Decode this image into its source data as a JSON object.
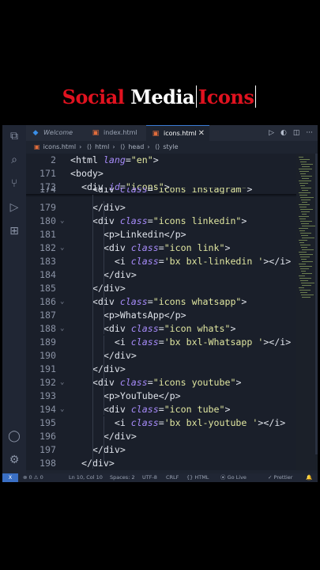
{
  "title": {
    "word1": "Social",
    "word2": "Media",
    "word3": "Icons"
  },
  "tabs": [
    {
      "label": "Welcome",
      "icon": "vscode-icon"
    },
    {
      "label": "index.html",
      "icon": "html5-icon"
    },
    {
      "label": "icons.html",
      "icon": "html5-icon",
      "active": true
    }
  ],
  "breadcrumb": [
    "icons.html",
    "html",
    "head",
    "style"
  ],
  "code_lines": [
    {
      "n": "2",
      "fold": "",
      "html": "<span class='p'>&lt;</span><span class='t'>html</span> <span class='a'>lang</span><span class='p'>=</span><span class='s'>\"en\"</span><span class='p'>&gt;</span>"
    },
    {
      "n": "171",
      "fold": "",
      "html": "<span class='p'>&lt;</span><span class='t'>body</span><span class='p'>&gt;</span>"
    },
    {
      "n": "173",
      "fold": "",
      "html": "  <span class='p'>&lt;</span><span class='t'>div</span> <span class='a'>id</span><span class='p'>=</span><span class='s'>\"icons\"</span><span class='p'>&gt;</span>"
    },
    {
      "n": "174",
      "fold": "",
      "html": "    <span class='p'>&lt;</span><span class='t'>div</span> <span class='a'>class</span><span class='p'>=</span><span class='s'>\"icons instagram\"</span><span class='p'>&gt;</span>"
    },
    {
      "n": "179",
      "fold": "",
      "html": "    <span class='p'>&lt;/</span><span class='t'>div</span><span class='p'>&gt;</span>"
    },
    {
      "n": "180",
      "fold": "v",
      "html": "    <span class='p'>&lt;</span><span class='t'>div</span> <span class='a'>class</span><span class='p'>=</span><span class='s'>\"icons linkedin\"</span><span class='p'>&gt;</span>"
    },
    {
      "n": "181",
      "fold": "",
      "html": "      <span class='p'>&lt;</span><span class='t'>p</span><span class='p'>&gt;Linkedin&lt;/</span><span class='t'>p</span><span class='p'>&gt;</span>"
    },
    {
      "n": "182",
      "fold": "v",
      "html": "      <span class='p'>&lt;</span><span class='t'>div</span> <span class='a'>class</span><span class='p'>=</span><span class='s'>\"icon link\"</span><span class='p'>&gt;</span>"
    },
    {
      "n": "183",
      "fold": "",
      "html": "        <span class='p'>&lt;</span><span class='t'>i</span> <span class='a'>class</span><span class='p'>=</span><span class='s'>'bx bxl-linkedin '</span><span class='p'>&gt;&lt;/</span><span class='t'>i</span><span class='p'>&gt;</span>"
    },
    {
      "n": "184",
      "fold": "",
      "html": "      <span class='p'>&lt;/</span><span class='t'>div</span><span class='p'>&gt;</span>"
    },
    {
      "n": "185",
      "fold": "",
      "html": "    <span class='p'>&lt;/</span><span class='t'>div</span><span class='p'>&gt;</span>"
    },
    {
      "n": "186",
      "fold": "v",
      "html": "    <span class='p'>&lt;</span><span class='t'>div</span> <span class='a'>class</span><span class='p'>=</span><span class='s'>\"icons whatsapp\"</span><span class='p'>&gt;</span>"
    },
    {
      "n": "187",
      "fold": "",
      "html": "      <span class='p'>&lt;</span><span class='t'>p</span><span class='p'>&gt;WhatsApp&lt;/</span><span class='t'>p</span><span class='p'>&gt;</span>"
    },
    {
      "n": "188",
      "fold": "v",
      "html": "      <span class='p'>&lt;</span><span class='t'>div</span> <span class='a'>class</span><span class='p'>=</span><span class='s'>\"icon whats\"</span><span class='p'>&gt;</span>"
    },
    {
      "n": "189",
      "fold": "",
      "html": "        <span class='p'>&lt;</span><span class='t'>i</span> <span class='a'>class</span><span class='p'>=</span><span class='s'>'bx bxl-Whatsapp '</span><span class='p'>&gt;&lt;/</span><span class='t'>i</span><span class='p'>&gt;</span>"
    },
    {
      "n": "190",
      "fold": "",
      "html": "      <span class='p'>&lt;/</span><span class='t'>div</span><span class='p'>&gt;</span>"
    },
    {
      "n": "191",
      "fold": "",
      "html": "    <span class='p'>&lt;/</span><span class='t'>div</span><span class='p'>&gt;</span>"
    },
    {
      "n": "192",
      "fold": "v",
      "html": "    <span class='p'>&lt;</span><span class='t'>div</span> <span class='a'>class</span><span class='p'>=</span><span class='s'>\"icons youtube\"</span><span class='p'>&gt;</span>"
    },
    {
      "n": "193",
      "fold": "",
      "html": "      <span class='p'>&lt;</span><span class='t'>p</span><span class='p'>&gt;YouTube&lt;/</span><span class='t'>p</span><span class='p'>&gt;</span>"
    },
    {
      "n": "194",
      "fold": "v",
      "html": "      <span class='p'>&lt;</span><span class='t'>div</span> <span class='a'>class</span><span class='p'>=</span><span class='s'>\"icon tube\"</span><span class='p'>&gt;</span>"
    },
    {
      "n": "195",
      "fold": "",
      "html": "        <span class='p'>&lt;</span><span class='t'>i</span> <span class='a'>class</span><span class='p'>=</span><span class='s'>'bx bxl-youtube '</span><span class='p'>&gt;&lt;/</span><span class='t'>i</span><span class='p'>&gt;</span>"
    },
    {
      "n": "196",
      "fold": "",
      "html": "      <span class='p'>&lt;/</span><span class='t'>div</span><span class='p'>&gt;</span>"
    },
    {
      "n": "197",
      "fold": "",
      "html": "    <span class='p'>&lt;/</span><span class='t'>div</span><span class='p'>&gt;</span>"
    },
    {
      "n": "198",
      "fold": "",
      "html": "  <span class='p'>&lt;/</span><span class='t'>div</span><span class='p'>&gt;</span>"
    }
  ],
  "status": {
    "remote": "X",
    "problems": "⊗ 0 ⚠ 0",
    "position": "Ln 10, Col 10",
    "spaces": "Spaces: 2",
    "encoding": "UTF-8",
    "eol": "CRLF",
    "language": "{} HTML",
    "golive": "Go Live",
    "prettier": "✓ Prettier"
  }
}
